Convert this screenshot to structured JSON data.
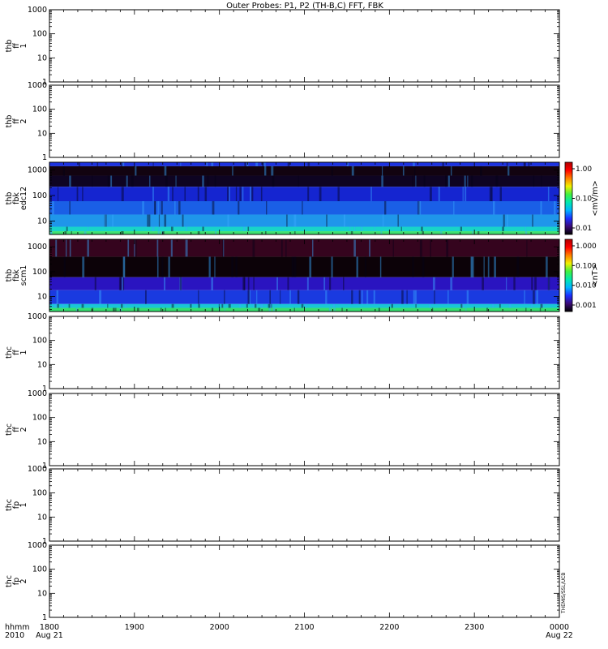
{
  "title": "Outer Probes: P1, P2 (TH-B,C) FFT, FBK",
  "x_axis": {
    "ticks": [
      "1800",
      "1900",
      "2000",
      "2100",
      "2200",
      "2300",
      "0000"
    ],
    "date_start": "Aug 21",
    "date_end": "Aug 22",
    "label_line1": "hhmm",
    "label_line2": "2010"
  },
  "side_note": "THEMIS/SSL/UCB",
  "chart_data": [
    {
      "type": "line",
      "panel": "thb_ff1",
      "ylabel": [
        "thb",
        "ff",
        "1"
      ],
      "scale": "log",
      "ylim": [
        1,
        1000
      ],
      "yticks": [
        "1",
        "10",
        "100",
        "1000"
      ],
      "series": []
    },
    {
      "type": "line",
      "panel": "thb_ff2",
      "ylabel": [
        "thb",
        "ff",
        "2"
      ],
      "scale": "log",
      "ylim": [
        1,
        1000
      ],
      "yticks": [
        "1",
        "10",
        "100",
        "1000"
      ],
      "series": []
    },
    {
      "type": "heatmap",
      "panel": "thb_fbk_edc12",
      "ylabel": [
        "thb",
        "fbk",
        "edc12"
      ],
      "scale": "log",
      "ylim": [
        3,
        2000
      ],
      "yticks": [
        "10",
        "100",
        "1000"
      ],
      "colorbar": {
        "label": "<mV/m>",
        "ticks": [
          "0.01",
          "0.10",
          "1.00"
        ]
      },
      "bands": [
        {
          "f_lo": 1400,
          "f_hi": 2000,
          "color": "#1c32e0"
        },
        {
          "f_lo": 600,
          "f_hi": 1400,
          "color": "#120310"
        },
        {
          "f_lo": 220,
          "f_hi": 600,
          "color": "#0e0422"
        },
        {
          "f_lo": 60,
          "f_hi": 220,
          "color": "#1525d0"
        },
        {
          "f_lo": 18,
          "f_hi": 60,
          "color": "#1a5fe6"
        },
        {
          "f_lo": 6,
          "f_hi": 18,
          "color": "#1f96ea"
        },
        {
          "f_lo": 4,
          "f_hi": 6,
          "color": "#18d4c8"
        },
        {
          "f_lo": 3,
          "f_hi": 4,
          "color": "#3ee070"
        }
      ]
    },
    {
      "type": "heatmap",
      "panel": "thb_fbk_scm1",
      "ylabel": [
        "thb",
        "fbk",
        "scm1"
      ],
      "scale": "log",
      "ylim": [
        2.5,
        2000
      ],
      "yticks": [
        "10",
        "100",
        "1000"
      ],
      "colorbar": {
        "label": "<nT>",
        "ticks": [
          "0.001",
          "0.010",
          "0.100",
          "1.000"
        ]
      },
      "bands": [
        {
          "f_lo": 400,
          "f_hi": 2000,
          "color": "#35041e"
        },
        {
          "f_lo": 60,
          "f_hi": 400,
          "color": "#0c0208"
        },
        {
          "f_lo": 18,
          "f_hi": 60,
          "color": "#2a14c0"
        },
        {
          "f_lo": 5,
          "f_hi": 18,
          "color": "#1a3ae0"
        },
        {
          "f_lo": 3.5,
          "f_hi": 5,
          "color": "#19c6d6"
        },
        {
          "f_lo": 2.5,
          "f_hi": 3.5,
          "color": "#35e06e"
        }
      ]
    },
    {
      "type": "line",
      "panel": "thc_ff1",
      "ylabel": [
        "thc",
        "ff",
        "1"
      ],
      "scale": "log",
      "ylim": [
        1,
        1000
      ],
      "yticks": [
        "1",
        "10",
        "100",
        "1000"
      ],
      "series": []
    },
    {
      "type": "line",
      "panel": "thc_ff2",
      "ylabel": [
        "thc",
        "ff",
        "2"
      ],
      "scale": "log",
      "ylim": [
        1,
        1000
      ],
      "yticks": [
        "1",
        "10",
        "100",
        "1000"
      ],
      "series": []
    },
    {
      "type": "line",
      "panel": "thc_fp1",
      "ylabel": [
        "thc",
        "fp",
        "1"
      ],
      "scale": "log",
      "ylim": [
        1,
        1000
      ],
      "yticks": [
        "1",
        "10",
        "100",
        "1000"
      ],
      "series": []
    },
    {
      "type": "line",
      "panel": "thc_fp2",
      "ylabel": [
        "thc",
        "fp",
        "2"
      ],
      "scale": "log",
      "ylim": [
        1,
        1000
      ],
      "yticks": [
        "1",
        "10",
        "100",
        "1000"
      ],
      "series": []
    }
  ]
}
